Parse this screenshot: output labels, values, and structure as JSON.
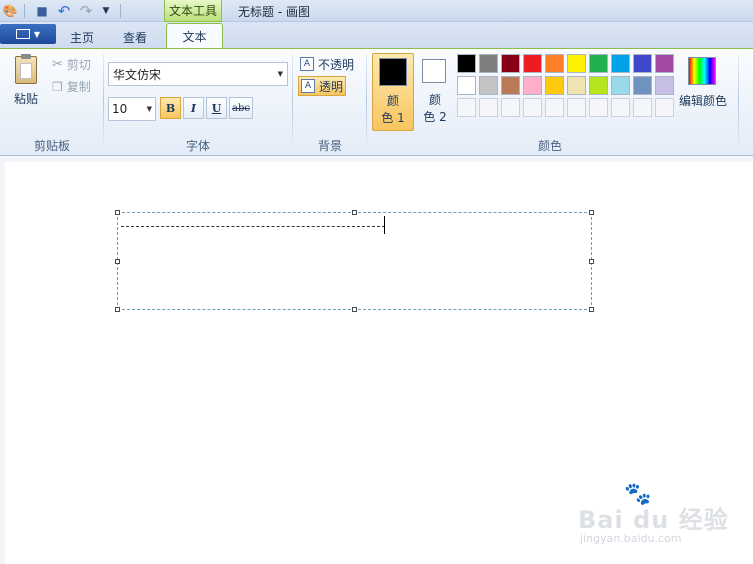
{
  "titlebar": {
    "context_tab": "文本工具",
    "window_title": "无标题 - 画图",
    "quick_access": [
      "paint-app-icon",
      "save-icon",
      "undo-icon",
      "redo-icon",
      "customize-dropdown-icon"
    ]
  },
  "tabs": {
    "home": "主页",
    "view": "查看",
    "text": "文本"
  },
  "clipboard": {
    "paste": "粘贴",
    "cut": "剪切",
    "copy": "复制",
    "group": "剪贴板"
  },
  "font": {
    "family": "华文仿宋",
    "size": "10",
    "bold": "B",
    "italic": "I",
    "underline": "U",
    "strike": "abc",
    "group": "字体"
  },
  "background": {
    "opaque": "不透明",
    "transparent": "透明",
    "group": "背景",
    "selected": "transparent"
  },
  "colors": {
    "color1_label_a": "颜",
    "color1_label_b": "色 1",
    "color2_label_a": "颜",
    "color2_label_b": "色 2",
    "color1": "#000000",
    "color2": "#ffffff",
    "edit": "编辑颜色",
    "group": "颜色",
    "palette": [
      [
        "#000000",
        "#7f7f7f",
        "#880015",
        "#ed1c24",
        "#ff7f27",
        "#fff200",
        "#22b14c",
        "#00a2e8",
        "#3f48cc",
        "#a349a4"
      ],
      [
        "#ffffff",
        "#c3c3c3",
        "#b97a57",
        "#ffaec9",
        "#ffc90e",
        "#efe4b0",
        "#b5e61d",
        "#99d9ea",
        "#7092be",
        "#c8bfe7"
      ],
      [
        "",
        "",
        "",
        "",
        "",
        "",
        "",
        "",
        "",
        ""
      ]
    ]
  },
  "watermark": {
    "brand": "Bai du 经验",
    "url": "jingyan.baidu.com"
  }
}
